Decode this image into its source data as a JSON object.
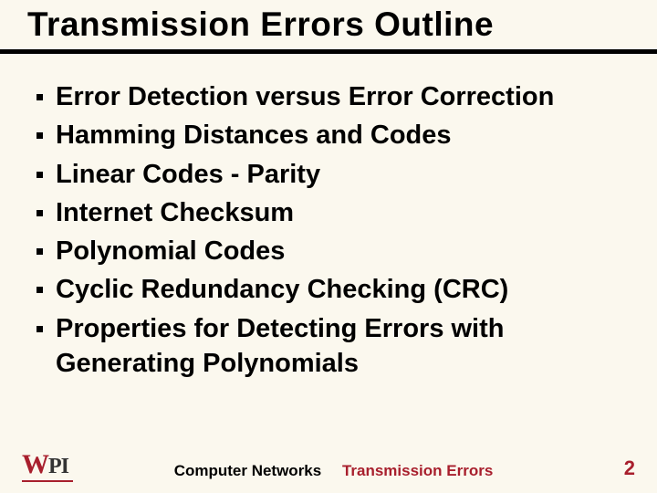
{
  "title": "Transmission Errors Outline",
  "bullets": [
    "Error Detection versus Error Correction",
    "Hamming Distances and Codes",
    "Linear Codes - Parity",
    "Internet Checksum",
    "Polynomial Codes",
    "Cyclic Redundancy Checking (CRC)",
    "Properties for Detecting Errors with Generating Polynomials"
  ],
  "footer": {
    "logo_w": "W",
    "logo_pi": "PI",
    "center_label_1": "Computer Networks",
    "center_label_2": "Transmission Errors",
    "page_number": "2"
  },
  "colors": {
    "accent": "#a81f2d",
    "background": "#fbf8ee"
  }
}
